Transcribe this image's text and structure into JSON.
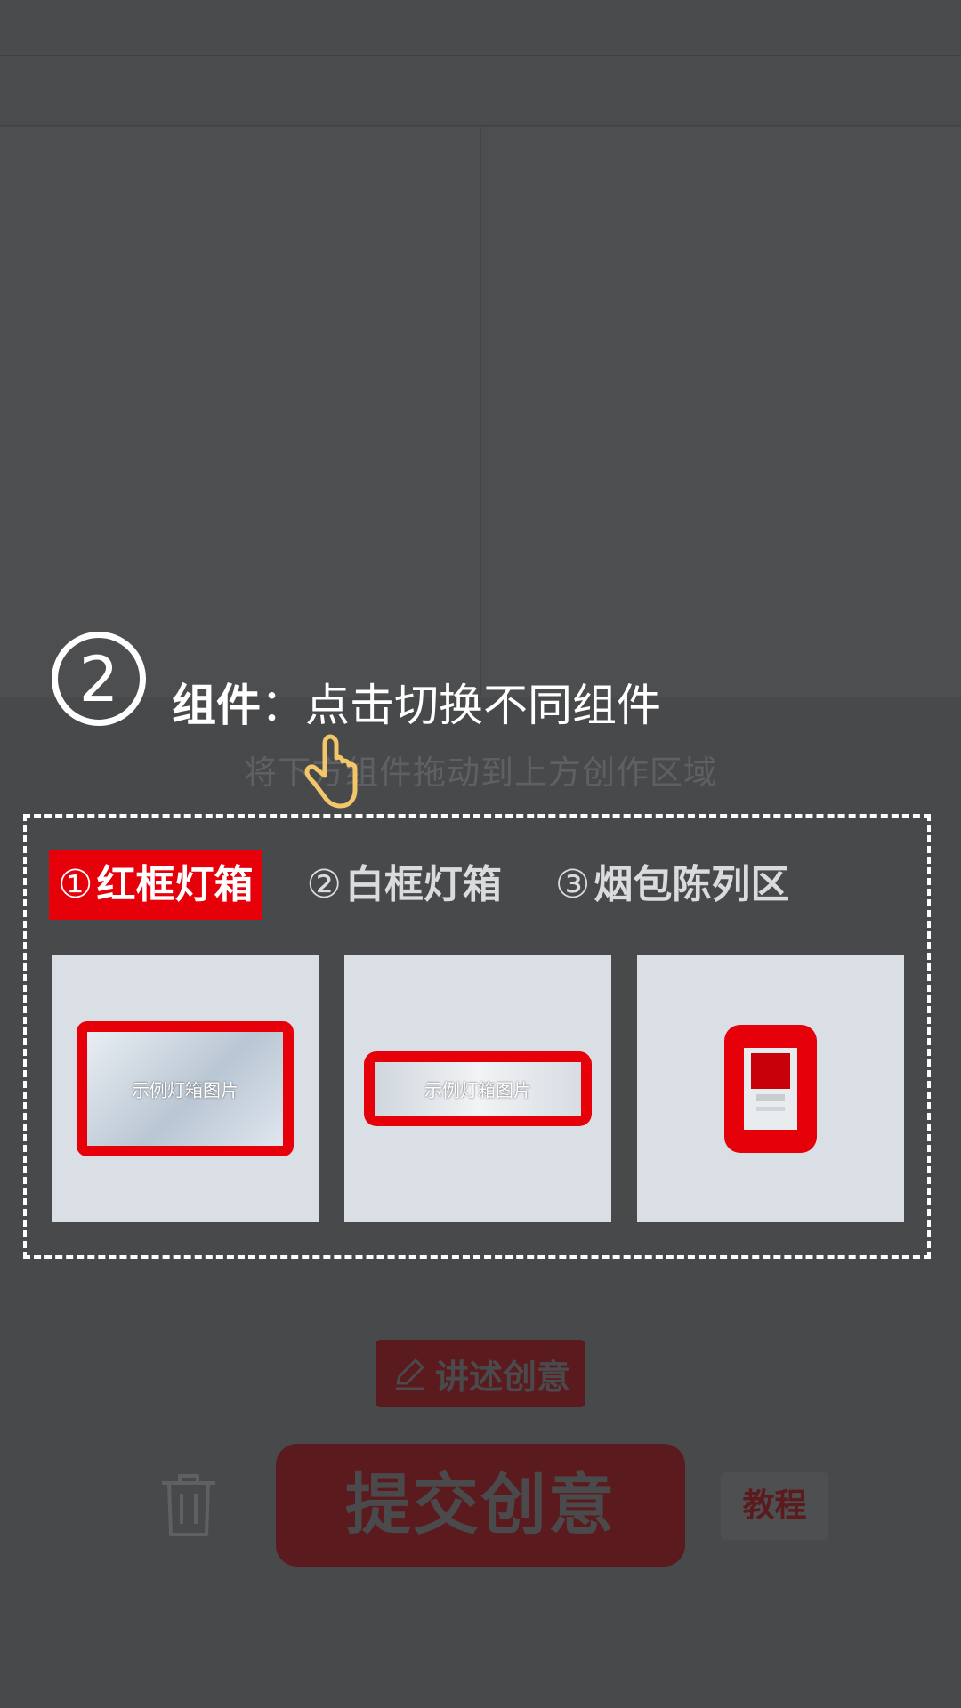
{
  "guide": {
    "step_number": "2",
    "title_bold": "组件",
    "title_separator": "：",
    "title_rest": "点击切换不同组件"
  },
  "background": {
    "hint": "将下方组件拖动到上方创作区域"
  },
  "tabs": [
    {
      "num": "①",
      "label": "红框灯箱",
      "active": true
    },
    {
      "num": "②",
      "label": "白框灯箱",
      "active": false
    },
    {
      "num": "③",
      "label": "烟包陈列区",
      "active": false
    }
  ],
  "cards": [
    {
      "label": "示例灯箱图片"
    },
    {
      "label": "示例灯箱图片"
    },
    {
      "label": ""
    }
  ],
  "actions": {
    "story": "讲述创意",
    "submit": "提交创意",
    "tutorial": "教程"
  },
  "colors": {
    "accent_red": "#e5000a",
    "overlay": "#48494b",
    "dimmed_red": "#5b1a1d"
  },
  "icons": [
    "hand-pointer-icon",
    "pencil-icon",
    "trash-icon"
  ]
}
